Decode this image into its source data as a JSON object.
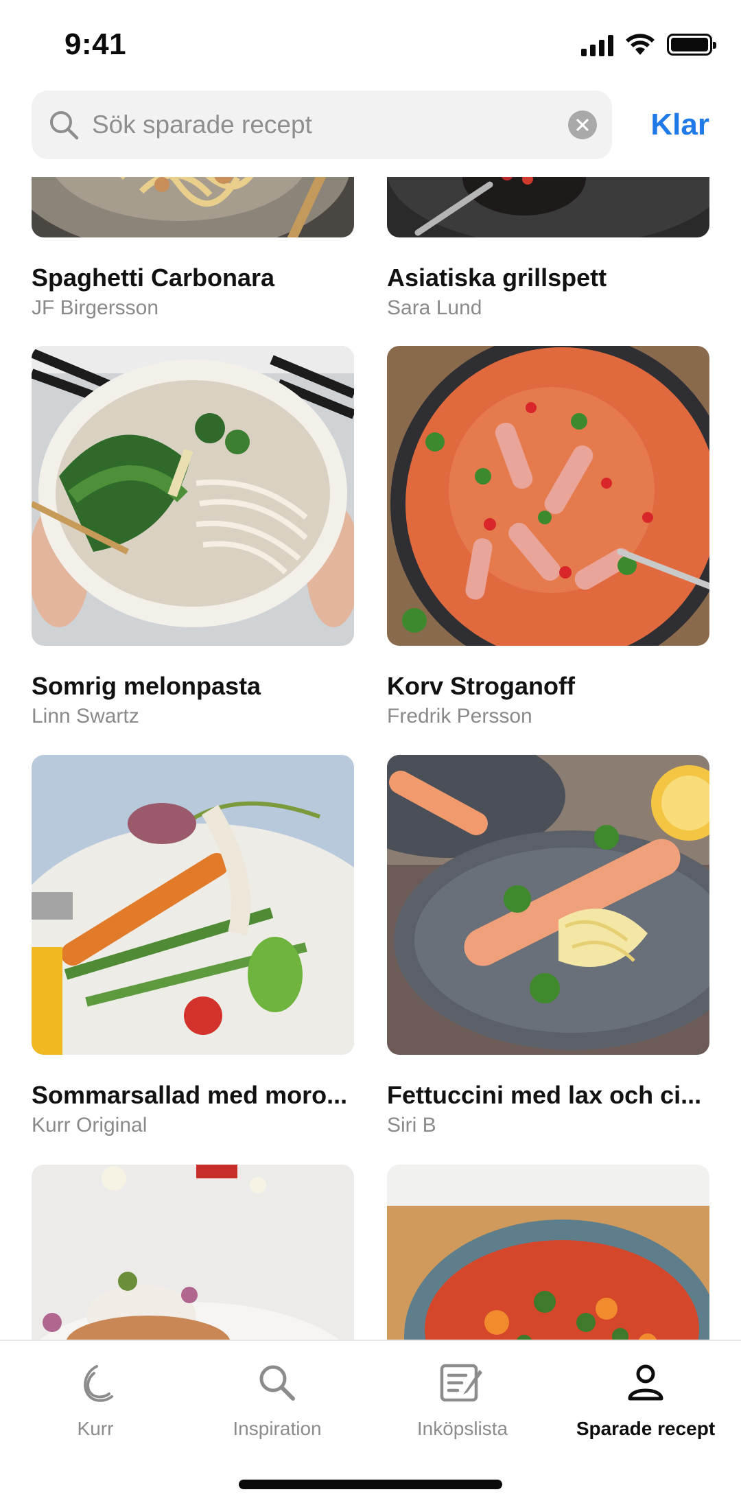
{
  "status_bar": {
    "time": "9:41"
  },
  "search": {
    "placeholder": "Sök sparade recept",
    "value": "",
    "done_label": "Klar"
  },
  "recipes": [
    {
      "title": "Spaghetti Carbonara",
      "author": "JF Birgersson",
      "image": "pasta-carbonara-bowl"
    },
    {
      "title": "Asiatiska grillspett",
      "author": "Sara Lund",
      "image": "grilled-skewers-dark"
    },
    {
      "title": "Somrig melonpasta",
      "author": "Linn Swartz",
      "image": "noodle-bowl-greens"
    },
    {
      "title": "Korv Stroganoff",
      "author": "Fredrik Persson",
      "image": "sausage-stroganoff-pan"
    },
    {
      "title": "Sommarsallad med moro...",
      "author": "Kurr Original",
      "image": "summer-salad-carrot"
    },
    {
      "title": "Fettuccini med lax och ci...",
      "author": "Siri B",
      "image": "salmon-fettuccine-plate"
    },
    {
      "title": "",
      "author": "",
      "image": "fish-dish-white"
    },
    {
      "title": "",
      "author": "",
      "image": "tomato-soup-bowl"
    }
  ],
  "tabs": [
    {
      "label": "Kurr",
      "icon": "kurr-logo-icon",
      "active": false
    },
    {
      "label": "Inspiration",
      "icon": "search-icon",
      "active": false
    },
    {
      "label": "Inköpslista",
      "icon": "shopping-list-icon",
      "active": false
    },
    {
      "label": "Sparade recept",
      "icon": "person-icon",
      "active": true
    }
  ],
  "colors": {
    "accent": "#1f7ae8",
    "inactive": "#8c8c8c",
    "active": "#0d0d0d"
  }
}
